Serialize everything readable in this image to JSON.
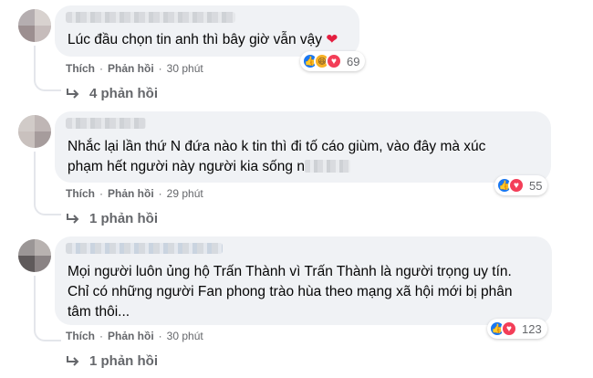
{
  "comments": [
    {
      "text": "Lúc đầu chọn tin anh thì bây giờ vẫn vậy",
      "emoji": "❤",
      "reaction_icons": [
        "like-icon",
        "haha-icon",
        "love-icon"
      ],
      "reaction_count": "69",
      "like_label": "Thích",
      "reply_label": "Phản hồi",
      "time": "30 phút",
      "replies_label": "4 phản hồi"
    },
    {
      "text_line1": "Nhắc lại lần thứ N đứa nào k tin thì đi tố cáo giùm, vào đây mà xúc",
      "text_line2": "phạm hết người này người kia sống n",
      "reaction_icons": [
        "like-icon",
        "love-icon"
      ],
      "reaction_count": "55",
      "like_label": "Thích",
      "reply_label": "Phản hồi",
      "time": "29 phút",
      "replies_label": "1 phản hồi"
    },
    {
      "text_line1": "Mọi người luôn ủng hộ Trấn Thành vì Trấn Thành là người trọng uy tín.",
      "text_line2": "Chỉ có những người Fan phong trào hùa theo mạng xã hội mới bị phân",
      "text_line3": "tâm thôi...",
      "reaction_icons": [
        "like-icon",
        "love-icon"
      ],
      "reaction_count": "123",
      "like_label": "Thích",
      "reply_label": "Phản hồi",
      "time": "30 phút",
      "replies_label": "1 phản hồi"
    }
  ],
  "colors": {
    "bubble": "#f0f2f5",
    "meta_text": "#65676b",
    "like": "#1877f2",
    "love": "#f33e58",
    "haha": "#f7b125"
  }
}
